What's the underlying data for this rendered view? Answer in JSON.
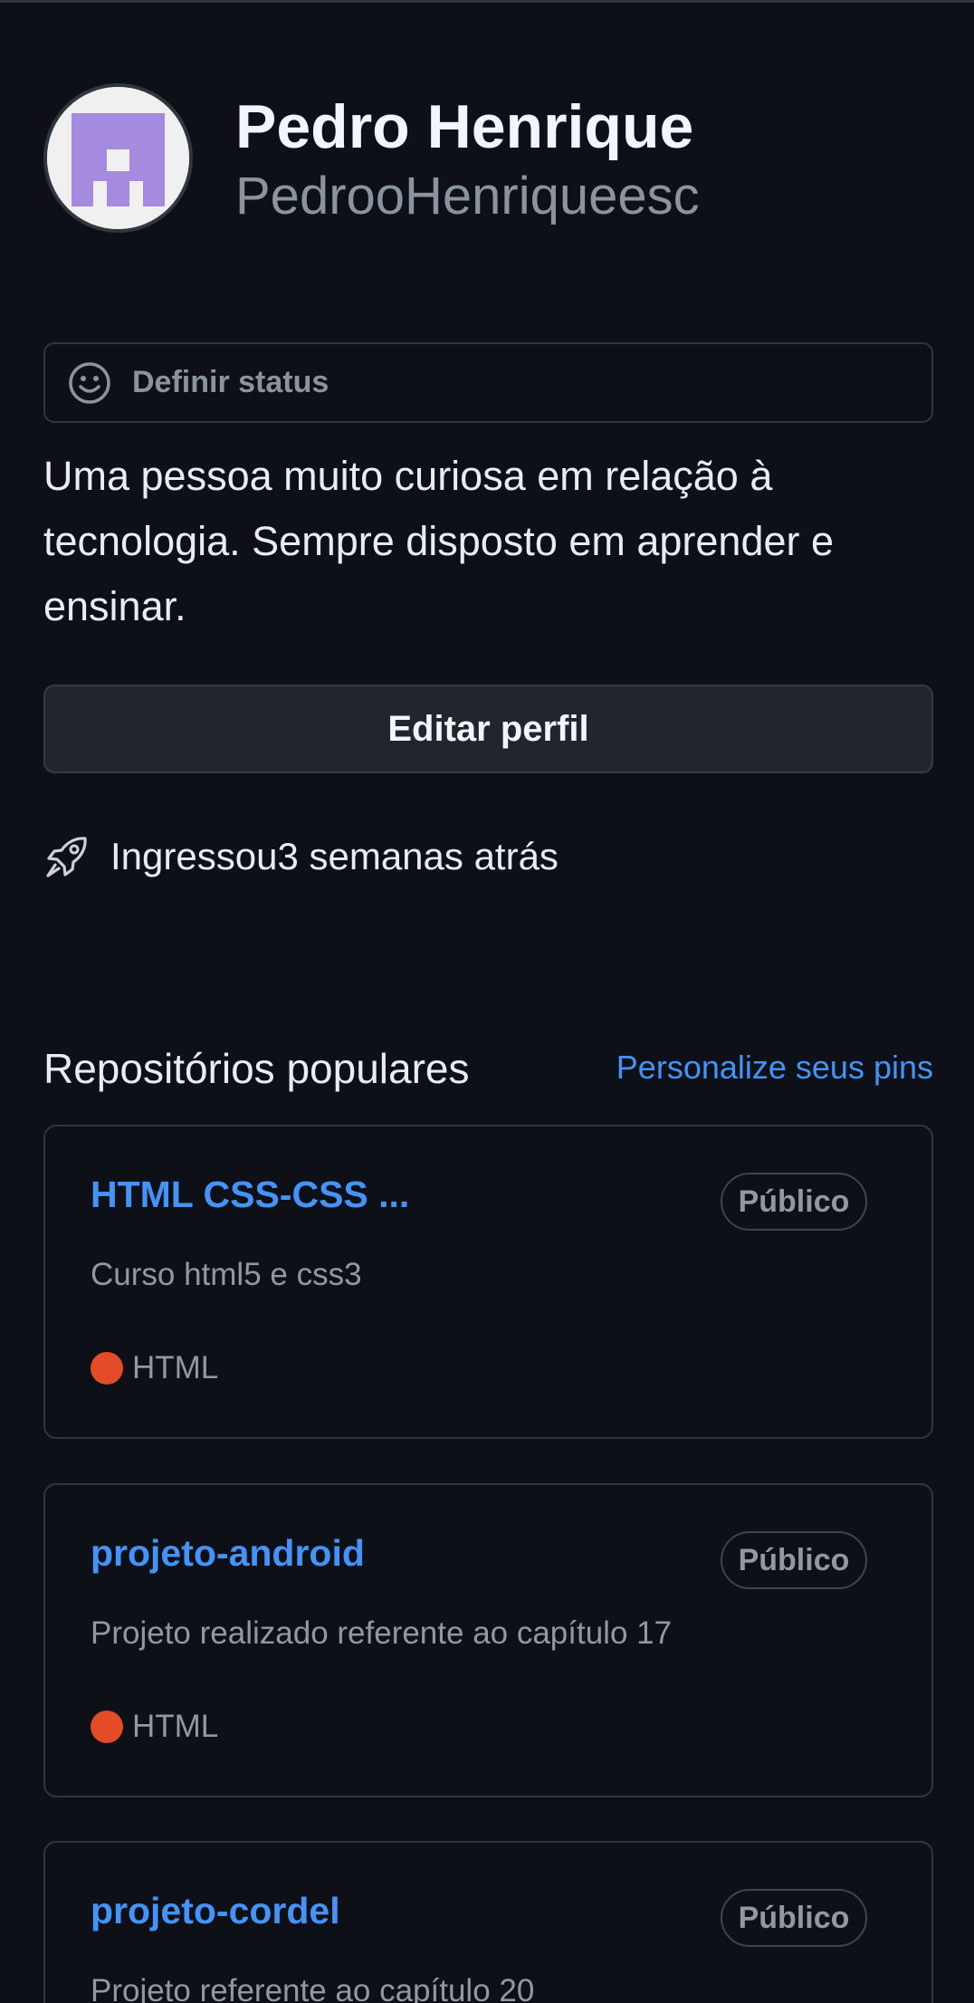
{
  "profile": {
    "display_name": "Pedro Henrique",
    "username": "PedrooHenriqueesc",
    "avatar_icon": "identicon-avatar",
    "set_status_label": "Definir status",
    "bio": "Uma pessoa muito curiosa em relação à tecnologia. Sempre disposto em aprender e ensinar.",
    "edit_profile_label": "Editar perfil",
    "joined_text": "Ingressou3 semanas atrás"
  },
  "popular": {
    "title": "Repositórios populares",
    "customize_label": "Personalize seus pins",
    "repos": [
      {
        "name": "HTML CSS-CSS ...",
        "visibility": "Público",
        "description": "Curso html5 e css3",
        "language": "HTML"
      },
      {
        "name": "projeto-android",
        "visibility": "Público",
        "description": "Projeto realizado referente ao capítulo 17",
        "language": "HTML"
      },
      {
        "name": "projeto-cordel",
        "visibility": "Público",
        "description": "Projeto referente ao capítulo 20"
      }
    ]
  },
  "colors": {
    "background": "#0d1117",
    "link": "#4493f8",
    "html_language": "#e34c26",
    "avatar_purple": "#a58be0"
  }
}
